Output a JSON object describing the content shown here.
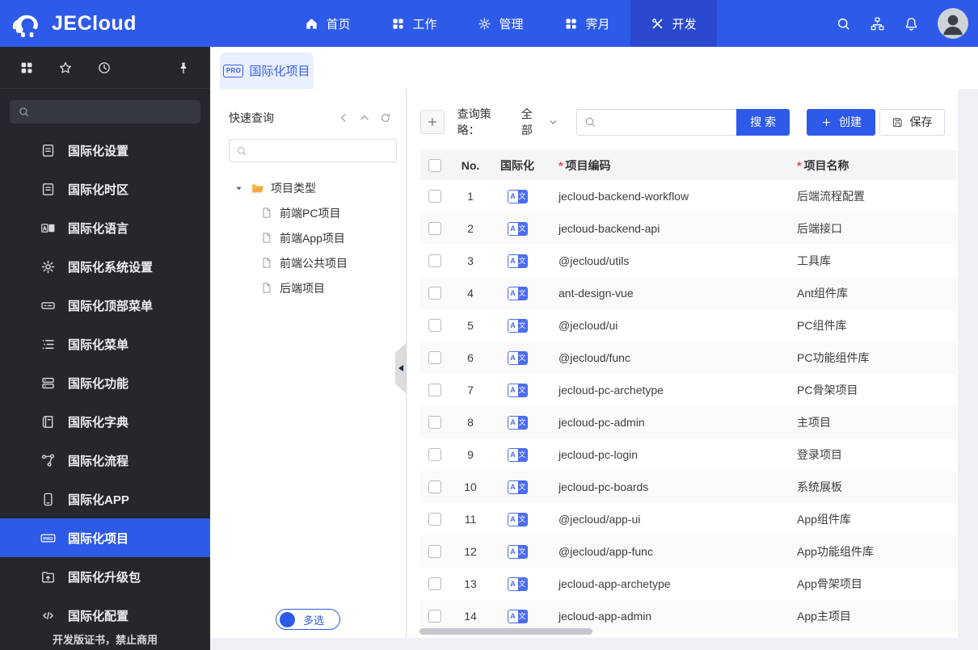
{
  "navbar": {
    "brand": "JECloud",
    "items": [
      {
        "label": "首页",
        "icon": "i-home",
        "active": false
      },
      {
        "label": "工作",
        "icon": "i-apps",
        "active": false
      },
      {
        "label": "管理",
        "icon": "i-gear",
        "active": false
      },
      {
        "label": "霁月",
        "icon": "i-apps",
        "active": false
      },
      {
        "label": "开发",
        "icon": "i-tools",
        "active": true
      }
    ],
    "right_icons": [
      "search-icon",
      "org-icon",
      "bell-icon",
      "avatar"
    ]
  },
  "sidebar": {
    "top_icons": [
      "apps-icon",
      "star-icon",
      "clock-icon",
      "pin-icon"
    ],
    "items": [
      {
        "label": "国际化设置",
        "icon": "i-doc",
        "selected": false
      },
      {
        "label": "国际化时区",
        "icon": "i-doc",
        "selected": false
      },
      {
        "label": "国际化语言",
        "icon": "i-lang",
        "selected": false
      },
      {
        "label": "国际化系统设置",
        "icon": "i-gear",
        "selected": false
      },
      {
        "label": "国际化顶部菜单",
        "icon": "i-topbar",
        "selected": false
      },
      {
        "label": "国际化菜单",
        "icon": "i-menu",
        "selected": false
      },
      {
        "label": "国际化功能",
        "icon": "i-func",
        "selected": false
      },
      {
        "label": "国际化字典",
        "icon": "i-dict",
        "selected": false
      },
      {
        "label": "国际化流程",
        "icon": "i-flow",
        "selected": false
      },
      {
        "label": "国际化APP",
        "icon": "i-app",
        "selected": false
      },
      {
        "label": "国际化项目",
        "icon": "i-pro",
        "selected": true
      },
      {
        "label": "国际化升级包",
        "icon": "i-upgrade",
        "selected": false
      },
      {
        "label": "国际化配置",
        "icon": "i-code",
        "selected": false
      }
    ],
    "footer": "开发版证书，禁止商用"
  },
  "tab": {
    "label": "国际化项目",
    "badge": "PRO"
  },
  "quick_panel": {
    "title": "快速查询",
    "header_icons": [
      "chevron-left-icon",
      "chevron-up-icon",
      "refresh-icon"
    ],
    "tree_root": "项目类型",
    "tree_children": [
      "前端PC项目",
      "前端App项目",
      "前端公共项目",
      "后端项目"
    ],
    "multi_select": "多选"
  },
  "toolbar": {
    "strategy_label": "查询策略：",
    "strategy_value": "全部",
    "search_button": "搜 索",
    "create_button": "创建",
    "save_button": "保存"
  },
  "table": {
    "headers": {
      "no": "No.",
      "i18n": "国际化",
      "code": "项目编码",
      "name": "项目名称"
    },
    "required_marker": "*",
    "badge": {
      "left": "A",
      "right": "文"
    },
    "rows": [
      {
        "no": 1,
        "code": "jecloud-backend-workflow",
        "name": "后端流程配置"
      },
      {
        "no": 2,
        "code": "jecloud-backend-api",
        "name": "后端接口"
      },
      {
        "no": 3,
        "code": "@jecloud/utils",
        "name": "工具库"
      },
      {
        "no": 4,
        "code": "ant-design-vue",
        "name": "Ant组件库"
      },
      {
        "no": 5,
        "code": "@jecloud/ui",
        "name": "PC组件库"
      },
      {
        "no": 6,
        "code": "@jecloud/func",
        "name": "PC功能组件库"
      },
      {
        "no": 7,
        "code": "jecloud-pc-archetype",
        "name": "PC骨架项目"
      },
      {
        "no": 8,
        "code": "jecloud-pc-admin",
        "name": "主项目"
      },
      {
        "no": 9,
        "code": "jecloud-pc-login",
        "name": "登录项目"
      },
      {
        "no": 10,
        "code": "jecloud-pc-boards",
        "name": "系统展板"
      },
      {
        "no": 11,
        "code": "@jecloud/app-ui",
        "name": "App组件库"
      },
      {
        "no": 12,
        "code": "@jecloud/app-func",
        "name": "App功能组件库"
      },
      {
        "no": 13,
        "code": "jecloud-app-archetype",
        "name": "App骨架项目"
      },
      {
        "no": 14,
        "code": "jecloud-app-admin",
        "name": "App主项目"
      }
    ]
  },
  "colors": {
    "accent": "#2e5ae9",
    "nav_active": "#2a49cf",
    "sidebar_bg": "#26272c",
    "tab_bg": "#e8efff",
    "page_bg": "#eef0f5",
    "row_alt": "#fafafa",
    "required": "#f0433e",
    "badge_blue": "#4a6cf0",
    "folder_orange": "#f7a941"
  }
}
